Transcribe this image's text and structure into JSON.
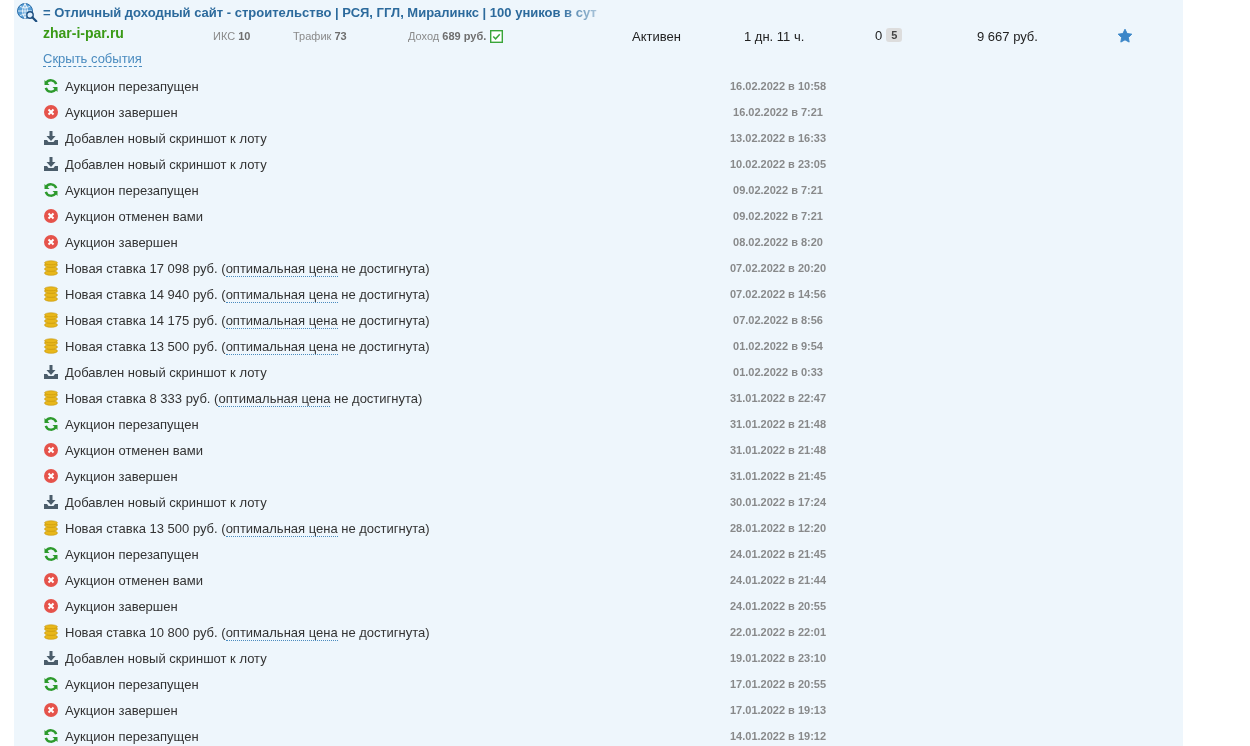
{
  "lot": {
    "title": "= Отличный доходный сайт - строительство | РСЯ, ГГЛ, Миралинкс | 100 уников в сут",
    "domain": "zhar-i-par.ru",
    "iks_label": "ИКС",
    "iks": "10",
    "traffic_label": "Трафик",
    "traffic": "73",
    "income_label": "Доход",
    "income": "689 руб.",
    "income_verified": true,
    "status": "Активен",
    "time_left": "1 дн. 11 ч.",
    "bids": "0",
    "comments": "5",
    "price": "9 667 руб.",
    "favorite": true,
    "toggle_link": "Скрыть события"
  },
  "events": [
    {
      "kind": "restart",
      "text": "Аукцион перезапущен",
      "date": "16.02.2022 в 10:58"
    },
    {
      "kind": "ended",
      "text": "Аукцион завершен",
      "date": "16.02.2022 в 7:21"
    },
    {
      "kind": "screenshot",
      "text": "Добавлен новый скриншот к лоту",
      "date": "13.02.2022 в 16:33"
    },
    {
      "kind": "screenshot",
      "text": "Добавлен новый скриншот к лоту",
      "date": "10.02.2022 в 23:05"
    },
    {
      "kind": "restart",
      "text": "Аукцион перезапущен",
      "date": "09.02.2022 в 7:21"
    },
    {
      "kind": "ended",
      "text": "Аукцион отменен вами",
      "date": "09.02.2022 в 7:21"
    },
    {
      "kind": "ended",
      "text": "Аукцион завершен",
      "date": "08.02.2022 в 8:20"
    },
    {
      "kind": "bid",
      "text": "Новая ставка 17 098 руб. (",
      "link": "оптимальная цена",
      "suffix": " не достигнута)",
      "date": "07.02.2022 в 20:20"
    },
    {
      "kind": "bid",
      "text": "Новая ставка 14 940 руб. (",
      "link": "оптимальная цена",
      "suffix": " не достигнута)",
      "date": "07.02.2022 в 14:56"
    },
    {
      "kind": "bid",
      "text": "Новая ставка 14 175 руб. (",
      "link": "оптимальная цена",
      "suffix": " не достигнута)",
      "date": "07.02.2022 в 8:56"
    },
    {
      "kind": "bid",
      "text": "Новая ставка 13 500 руб. (",
      "link": "оптимальная цена",
      "suffix": " не достигнута)",
      "date": "01.02.2022 в 9:54"
    },
    {
      "kind": "screenshot",
      "text": "Добавлен новый скриншот к лоту",
      "date": "01.02.2022 в 0:33"
    },
    {
      "kind": "bid",
      "text": "Новая ставка 8 333 руб. (",
      "link": "оптимальная цена",
      "suffix": " не достигнута)",
      "date": "31.01.2022 в 22:47"
    },
    {
      "kind": "restart",
      "text": "Аукцион перезапущен",
      "date": "31.01.2022 в 21:48"
    },
    {
      "kind": "ended",
      "text": "Аукцион отменен вами",
      "date": "31.01.2022 в 21:48"
    },
    {
      "kind": "ended",
      "text": "Аукцион завершен",
      "date": "31.01.2022 в 21:45"
    },
    {
      "kind": "screenshot",
      "text": "Добавлен новый скриншот к лоту",
      "date": "30.01.2022 в 17:24"
    },
    {
      "kind": "bid",
      "text": "Новая ставка 13 500 руб. (",
      "link": "оптимальная цена",
      "suffix": " не достигнута)",
      "date": "28.01.2022 в 12:20"
    },
    {
      "kind": "restart",
      "text": "Аукцион перезапущен",
      "date": "24.01.2022 в 21:45"
    },
    {
      "kind": "ended",
      "text": "Аукцион отменен вами",
      "date": "24.01.2022 в 21:44"
    },
    {
      "kind": "ended",
      "text": "Аукцион завершен",
      "date": "24.01.2022 в 20:55"
    },
    {
      "kind": "bid",
      "text": "Новая ставка 10 800 руб. (",
      "link": "оптимальная цена",
      "suffix": " не достигнута)",
      "date": "22.01.2022 в 22:01"
    },
    {
      "kind": "screenshot",
      "text": "Добавлен новый скриншот к лоту",
      "date": "19.01.2022 в 23:10"
    },
    {
      "kind": "restart",
      "text": "Аукцион перезапущен",
      "date": "17.01.2022 в 20:55"
    },
    {
      "kind": "ended",
      "text": "Аукцион завершен",
      "date": "17.01.2022 в 19:13"
    },
    {
      "kind": "restart",
      "text": "Аукцион перезапущен",
      "date": "14.01.2022 в 19:12"
    }
  ]
}
